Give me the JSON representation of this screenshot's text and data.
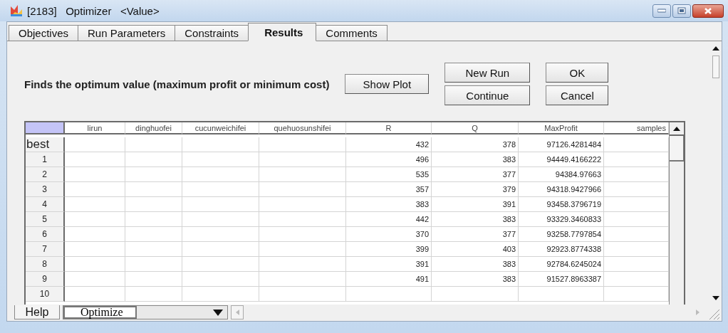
{
  "window": {
    "title": "[2183]   Optimizer   <Value>"
  },
  "tabs": [
    {
      "label": "Objectives",
      "selected": false
    },
    {
      "label": "Run Parameters",
      "selected": false
    },
    {
      "label": "Constraints",
      "selected": false
    },
    {
      "label": "Results",
      "selected": true
    },
    {
      "label": "Comments",
      "selected": false
    }
  ],
  "description": "Finds the optimum value (maximum profit or minimum cost)",
  "buttons": {
    "show_plot": "Show Plot",
    "new_run": "New Run",
    "continue": "Continue",
    "ok": "OK",
    "cancel": "Cancel"
  },
  "table": {
    "columns": [
      "lirun",
      "dinghuofei",
      "cucunweichifei",
      "quehuosunshifei",
      "R",
      "Q",
      "MaxProfit",
      "samples"
    ],
    "rows": [
      {
        "label": "best",
        "kind": "best",
        "cells": [
          "",
          "",
          "",
          "",
          "432",
          "378",
          "97126.4281484",
          ""
        ]
      },
      {
        "label": "1",
        "kind": "run",
        "cells": [
          "",
          "",
          "",
          "",
          "496",
          "383",
          "94449.4166222",
          ""
        ]
      },
      {
        "label": "2",
        "kind": "run",
        "cells": [
          "",
          "",
          "",
          "",
          "535",
          "377",
          "94384.97663",
          ""
        ]
      },
      {
        "label": "3",
        "kind": "run",
        "cells": [
          "",
          "",
          "",
          "",
          "357",
          "379",
          "94318.9427966",
          ""
        ]
      },
      {
        "label": "4",
        "kind": "run",
        "cells": [
          "",
          "",
          "",
          "",
          "383",
          "391",
          "93458.3796719",
          ""
        ]
      },
      {
        "label": "5",
        "kind": "run",
        "cells": [
          "",
          "",
          "",
          "",
          "442",
          "383",
          "93329.3460833",
          ""
        ]
      },
      {
        "label": "6",
        "kind": "run",
        "cells": [
          "",
          "",
          "",
          "",
          "370",
          "377",
          "93258.7797854",
          ""
        ]
      },
      {
        "label": "7",
        "kind": "run",
        "cells": [
          "",
          "",
          "",
          "",
          "399",
          "403",
          "92923.8774338",
          ""
        ]
      },
      {
        "label": "8",
        "kind": "run",
        "cells": [
          "",
          "",
          "",
          "",
          "391",
          "383",
          "92784.6245024",
          ""
        ]
      },
      {
        "label": "9",
        "kind": "run",
        "cells": [
          "",
          "",
          "",
          "",
          "491",
          "383",
          "91527.8963387",
          ""
        ]
      },
      {
        "label": "10",
        "kind": "run",
        "cells": [
          "",
          "",
          "",
          "",
          "",
          "",
          "",
          ""
        ]
      }
    ]
  },
  "bottom_bar": {
    "help": "Help",
    "mode": "Optimize"
  }
}
